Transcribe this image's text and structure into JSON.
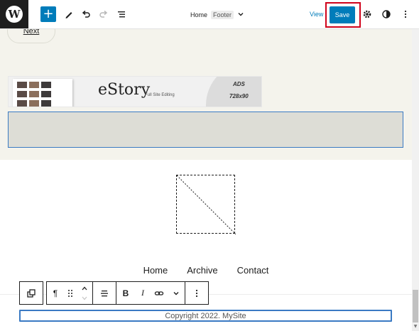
{
  "topbar": {
    "logo_glyph": "W",
    "add_label": "+",
    "title_home": "Home",
    "title_template": "Footer",
    "view_label": "View",
    "save_label": "Save",
    "icons": [
      "wordpress-logo-icon",
      "plus-icon",
      "pencil-icon",
      "undo-icon",
      "redo-icon",
      "list-view-icon",
      "chevron-down-icon",
      "gear-icon",
      "contrast-icon",
      "more-vertical-icon"
    ],
    "accent_color": "#007cba",
    "highlight_color": "#d0021b"
  },
  "canvas": {
    "next_label": "Next",
    "ad": {
      "logo": "eStory",
      "tagline": "Full Site Editing",
      "line1": "ADS",
      "line2": "728x90"
    },
    "nav": [
      "Home",
      "Archive",
      "Contact"
    ],
    "copyright": "Copyright 2022. MySite"
  },
  "block_toolbar": {
    "paragraph_glyph": "¶",
    "bold": "B",
    "italic": "I",
    "icons": [
      "transform-icon",
      "paragraph-icon",
      "drag-handle-icon",
      "move-up-icon",
      "move-down-icon",
      "align-icon",
      "bold-icon",
      "italic-icon",
      "link-icon",
      "chevron-down-icon",
      "more-vertical-icon"
    ]
  }
}
